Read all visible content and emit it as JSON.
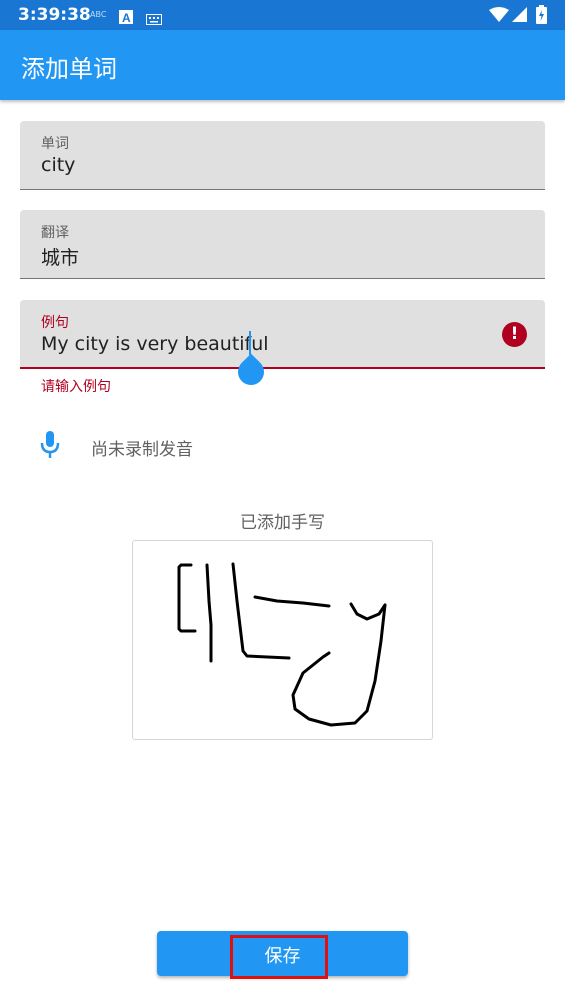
{
  "status_bar": {
    "time": "3:39:38",
    "abc_label": "ABC"
  },
  "app_bar": {
    "title": "添加单词"
  },
  "form": {
    "word": {
      "label": "单词",
      "value": "city"
    },
    "translation": {
      "label": "翻译",
      "value": "城市"
    },
    "example": {
      "label": "例句",
      "value": "My city is very beautiful",
      "error": "请输入例句"
    }
  },
  "audio": {
    "status": "尚未录制发音",
    "icon": "mic-icon"
  },
  "handwriting": {
    "caption": "已添加手写",
    "text_drawn": "city"
  },
  "actions": {
    "save_label": "保存"
  },
  "colors": {
    "primary": "#2196f3",
    "status_bar": "#1976d2",
    "error": "#b00020",
    "highlight": "#e01010"
  }
}
